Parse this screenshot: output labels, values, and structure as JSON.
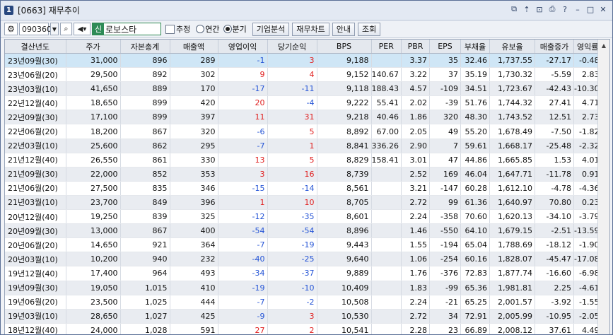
{
  "window": {
    "number": "1",
    "title": "[0663] 재무추이"
  },
  "toolbar": {
    "code": "090360",
    "stock_badge": "신",
    "stock_name": "로보스타",
    "estimate_label": "추정",
    "annual_label": "연간",
    "quarterly_label": "분기",
    "buttons": [
      "기업분석",
      "재무차트",
      "안내",
      "조회"
    ]
  },
  "table": {
    "headers": [
      "결산년도",
      "주가",
      "자본총계",
      "매출액",
      "영업이익",
      "당기순익",
      "BPS",
      "PER",
      "PBR",
      "EPS",
      "부채율",
      "유보율",
      "매출증가",
      "영익률"
    ],
    "rows": [
      [
        "23년09월(30)",
        "31,000",
        "896",
        "289",
        "-1",
        "3",
        "9,188",
        "",
        "3.37",
        "35",
        "32.46",
        "1,737.55",
        "-27.17",
        "-0.48"
      ],
      [
        "23년06월(20)",
        "29,500",
        "892",
        "302",
        "9",
        "4",
        "9,152",
        "140.67",
        "3.22",
        "37",
        "35.19",
        "1,730.32",
        "-5.59",
        "2.83"
      ],
      [
        "23년03월(10)",
        "41,650",
        "889",
        "170",
        "-17",
        "-11",
        "9,118",
        "188.43",
        "4.57",
        "-109",
        "34.51",
        "1,723.67",
        "-42.43",
        "-10.30"
      ],
      [
        "22년12월(40)",
        "18,650",
        "899",
        "420",
        "20",
        "-4",
        "9,222",
        "55.41",
        "2.02",
        "-39",
        "51.76",
        "1,744.32",
        "27.41",
        "4.71"
      ],
      [
        "22년09월(30)",
        "17,100",
        "899",
        "397",
        "11",
        "31",
        "9,218",
        "40.46",
        "1.86",
        "320",
        "48.30",
        "1,743.52",
        "12.51",
        "2.73"
      ],
      [
        "22년06월(20)",
        "18,200",
        "867",
        "320",
        "-6",
        "5",
        "8,892",
        "67.00",
        "2.05",
        "49",
        "55.20",
        "1,678.49",
        "-7.50",
        "-1.82"
      ],
      [
        "22년03월(10)",
        "25,600",
        "862",
        "295",
        "-7",
        "1",
        "8,841",
        "336.26",
        "2.90",
        "7",
        "59.61",
        "1,668.17",
        "-25.48",
        "-2.32"
      ],
      [
        "21년12월(40)",
        "26,550",
        "861",
        "330",
        "13",
        "5",
        "8,829",
        "158.41",
        "3.01",
        "47",
        "44.86",
        "1,665.85",
        "1.53",
        "4.01"
      ],
      [
        "21년09월(30)",
        "22,000",
        "852",
        "353",
        "3",
        "16",
        "8,739",
        "",
        "2.52",
        "169",
        "46.04",
        "1,647.71",
        "-11.78",
        "0.91"
      ],
      [
        "21년06월(20)",
        "27,500",
        "835",
        "346",
        "-15",
        "-14",
        "8,561",
        "",
        "3.21",
        "-147",
        "60.28",
        "1,612.10",
        "-4.78",
        "-4.36"
      ],
      [
        "21년03월(10)",
        "23,700",
        "849",
        "396",
        "1",
        "10",
        "8,705",
        "",
        "2.72",
        "99",
        "61.36",
        "1,640.97",
        "70.80",
        "0.23"
      ],
      [
        "20년12월(40)",
        "19,250",
        "839",
        "325",
        "-12",
        "-35",
        "8,601",
        "",
        "2.24",
        "-358",
        "70.60",
        "1,620.13",
        "-34.10",
        "-3.79"
      ],
      [
        "20년09월(30)",
        "13,000",
        "867",
        "400",
        "-54",
        "-54",
        "8,896",
        "",
        "1.46",
        "-550",
        "64.10",
        "1,679.15",
        "-2.51",
        "-13.59"
      ],
      [
        "20년06월(20)",
        "14,650",
        "921",
        "364",
        "-7",
        "-19",
        "9,443",
        "",
        "1.55",
        "-194",
        "65.04",
        "1,788.69",
        "-18.12",
        "-1.90"
      ],
      [
        "20년03월(10)",
        "10,200",
        "940",
        "232",
        "-40",
        "-25",
        "9,640",
        "",
        "1.06",
        "-254",
        "60.16",
        "1,828.07",
        "-45.47",
        "-17.08"
      ],
      [
        "19년12월(40)",
        "17,400",
        "964",
        "493",
        "-34",
        "-37",
        "9,889",
        "",
        "1.76",
        "-376",
        "72.83",
        "1,877.74",
        "-16.60",
        "-6.98"
      ],
      [
        "19년09월(30)",
        "19,050",
        "1,015",
        "410",
        "-19",
        "-10",
        "10,409",
        "",
        "1.83",
        "-99",
        "65.36",
        "1,981.81",
        "2.25",
        "-4.61"
      ],
      [
        "19년06월(20)",
        "23,500",
        "1,025",
        "444",
        "-7",
        "-2",
        "10,508",
        "",
        "2.24",
        "-21",
        "65.25",
        "2,001.57",
        "-3.92",
        "-1.55"
      ],
      [
        "19년03월(10)",
        "28,650",
        "1,027",
        "425",
        "-9",
        "3",
        "10,530",
        "",
        "2.72",
        "34",
        "72.91",
        "2,005.99",
        "-10.95",
        "-2.05"
      ],
      [
        "18년12월(40)",
        "24,000",
        "1,028",
        "591",
        "27",
        "2",
        "10,541",
        "",
        "2.28",
        "23",
        "66.89",
        "2,008.12",
        "37.61",
        "4.49"
      ]
    ]
  },
  "colors": {
    "negative": "#2454d6",
    "positive": "#e02020",
    "selected": "#cfe6f6"
  }
}
